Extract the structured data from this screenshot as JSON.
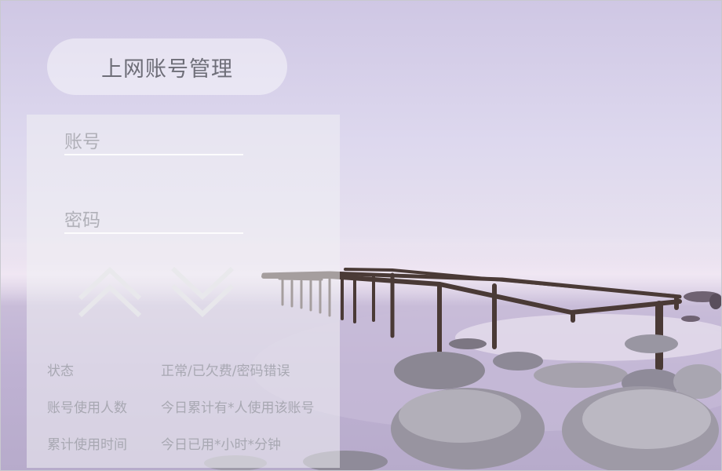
{
  "title": "上网账号管理",
  "form": {
    "account_placeholder": "账号",
    "password_placeholder": "密码"
  },
  "controls": {
    "up_icon": "chevron-up-icon",
    "down_icon": "chevron-down-icon"
  },
  "info": [
    {
      "label": "状态",
      "value": "正常/已欠费/密码错误"
    },
    {
      "label": "账号使用人数",
      "value": "今日累计有*人使用该账号"
    },
    {
      "label": "累计使用时间",
      "value": "今日已用*小时*分钟"
    }
  ],
  "colors": {
    "title_text": "#6e6e78",
    "info_text": "#a8a8b2",
    "pier": "#4a3a36"
  }
}
